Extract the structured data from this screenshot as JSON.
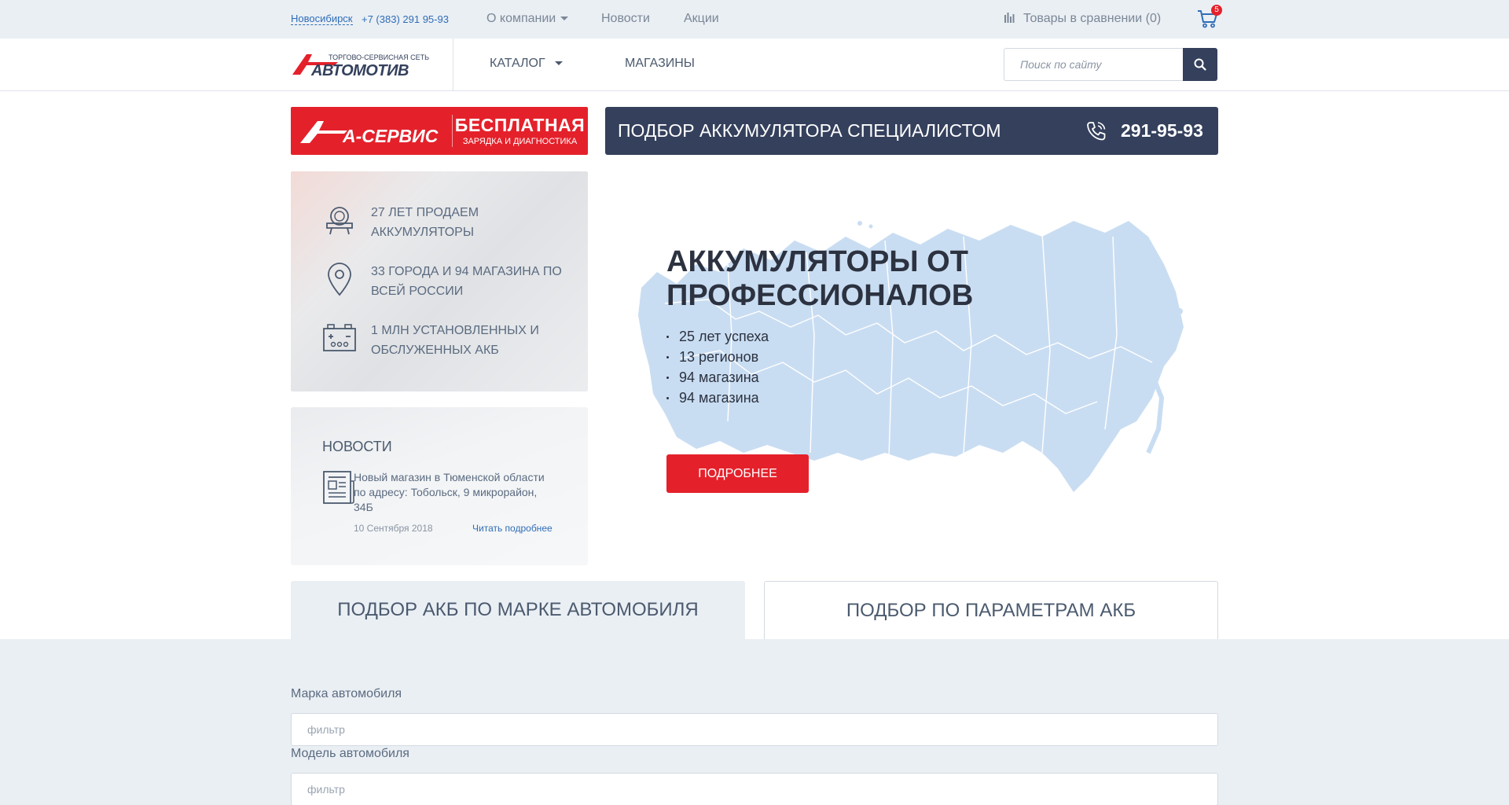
{
  "topbar": {
    "city": "Новосибирск",
    "phone": "+7 (383) 291 95-93",
    "menu": [
      {
        "label": "О компании"
      },
      {
        "label": "Новости"
      },
      {
        "label": "Акции"
      }
    ],
    "compare_label": "Товары в сравнении (0)",
    "cart_count": "5"
  },
  "header": {
    "logo_tagline": "ТОРГОВО-СЕРВИСНАЯ СЕТЬ",
    "logo_name": "АВТОМОТИВ",
    "nav": [
      {
        "label": "КАТАЛОГ"
      },
      {
        "label": "МАГАЗИНЫ"
      }
    ],
    "search_placeholder": "Поиск по сайту"
  },
  "service_banner": {
    "logo_text": "А-СЕРВИС",
    "title": "БЕСПЛАТНАЯ",
    "subtitle": "ЗАРЯДКА И ДИАГНОСТИКА"
  },
  "battery_banner": {
    "title": "ПОДБОР АККУМУЛЯТОРА СПЕЦИАЛИСТОМ",
    "phone": "291-95-93"
  },
  "stats": [
    {
      "text": "27 ЛЕТ ПРОДАЕМ АККУМУЛЯТОРЫ",
      "icon": "award-icon"
    },
    {
      "text": "33 ГОРОДА И 94 МАГАЗИНА ПО ВСЕЙ РОССИИ",
      "icon": "location-pin-icon"
    },
    {
      "text": "1 МЛН УСТАНОВЛЕННЫХ И ОБСЛУЖЕННЫХ АКБ",
      "icon": "battery-icon"
    }
  ],
  "news": {
    "title": "НОВОСТИ",
    "text": "Новый магазин в Тюменской области по адресу: Тобольск, 9 микрорайон, 34Б",
    "date": "10 Сентября 2018",
    "link": "Читать подробнее"
  },
  "hero": {
    "title": "АККУМУЛЯТОРЫ ОТ ПРОФЕССИОНАЛОВ",
    "items": [
      "25 лет успеха",
      "13 регионов",
      "94 магазина",
      "94 магазина"
    ],
    "button": "ПОДРОБНЕЕ"
  },
  "tabs": [
    {
      "label": "ПОДБОР АКБ ПО МАРКЕ АВТОМОБИЛЯ",
      "active": true
    },
    {
      "label": "ПОДБОР ПО ПАРАМЕТРАМ АКБ",
      "active": false
    }
  ],
  "form": {
    "brand_label": "Марка автомобиля",
    "brand_placeholder": "фильтр",
    "model_label": "Модель автомобиля",
    "model_placeholder": "фильтр"
  },
  "colors": {
    "brand_red": "#e4212b",
    "navy": "#34405c",
    "link_blue": "#2f6db6",
    "light_bg": "#eaeff4",
    "map_blue": "#c9ddf2"
  }
}
